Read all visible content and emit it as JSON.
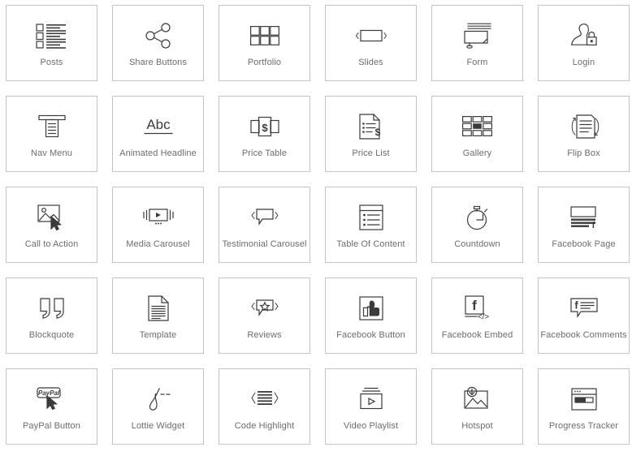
{
  "panel": {
    "name": "widget-picker-grid",
    "columns": 6,
    "rows": 5,
    "background_color": "#ffffff",
    "card_border_color": "#c4c4c4",
    "label_color": "#6e6e6e",
    "icon_color": "#3b3b3b"
  },
  "widgets": [
    {
      "label": "Posts",
      "icon": "posts-icon"
    },
    {
      "label": "Share Buttons",
      "icon": "share-buttons-icon"
    },
    {
      "label": "Portfolio",
      "icon": "portfolio-icon"
    },
    {
      "label": "Slides",
      "icon": "slides-icon"
    },
    {
      "label": "Form",
      "icon": "form-icon"
    },
    {
      "label": "Login",
      "icon": "login-icon"
    },
    {
      "label": "Nav Menu",
      "icon": "nav-menu-icon"
    },
    {
      "label": "Animated Headline",
      "icon": "animated-headline-icon"
    },
    {
      "label": "Price Table",
      "icon": "price-table-icon"
    },
    {
      "label": "Price List",
      "icon": "price-list-icon"
    },
    {
      "label": "Gallery",
      "icon": "gallery-icon"
    },
    {
      "label": "Flip Box",
      "icon": "flip-box-icon"
    },
    {
      "label": "Call to Action",
      "icon": "call-to-action-icon"
    },
    {
      "label": "Media Carousel",
      "icon": "media-carousel-icon"
    },
    {
      "label": "Testimonial Carousel",
      "icon": "testimonial-carousel-icon"
    },
    {
      "label": "Table Of Content",
      "icon": "table-of-content-icon"
    },
    {
      "label": "Countdown",
      "icon": "countdown-icon"
    },
    {
      "label": "Facebook Page",
      "icon": "facebook-page-icon"
    },
    {
      "label": "Blockquote",
      "icon": "blockquote-icon"
    },
    {
      "label": "Template",
      "icon": "template-icon"
    },
    {
      "label": "Reviews",
      "icon": "reviews-icon"
    },
    {
      "label": "Facebook Button",
      "icon": "facebook-button-icon"
    },
    {
      "label": "Facebook Embed",
      "icon": "facebook-embed-icon"
    },
    {
      "label": "Facebook Comments",
      "icon": "facebook-comments-icon"
    },
    {
      "label": "PayPal Button",
      "icon": "paypal-button-icon"
    },
    {
      "label": "Lottie Widget",
      "icon": "lottie-widget-icon"
    },
    {
      "label": "Code Highlight",
      "icon": "code-highlight-icon"
    },
    {
      "label": "Video Playlist",
      "icon": "video-playlist-icon"
    },
    {
      "label": "Hotspot",
      "icon": "hotspot-icon"
    },
    {
      "label": "Progress Tracker",
      "icon": "progress-tracker-icon"
    }
  ],
  "icon_glyphs": {
    "paypal_wordmark": "PayPal",
    "facebook_f": "f",
    "code_brackets": "</>",
    "animated_headline_text": "Abc"
  }
}
